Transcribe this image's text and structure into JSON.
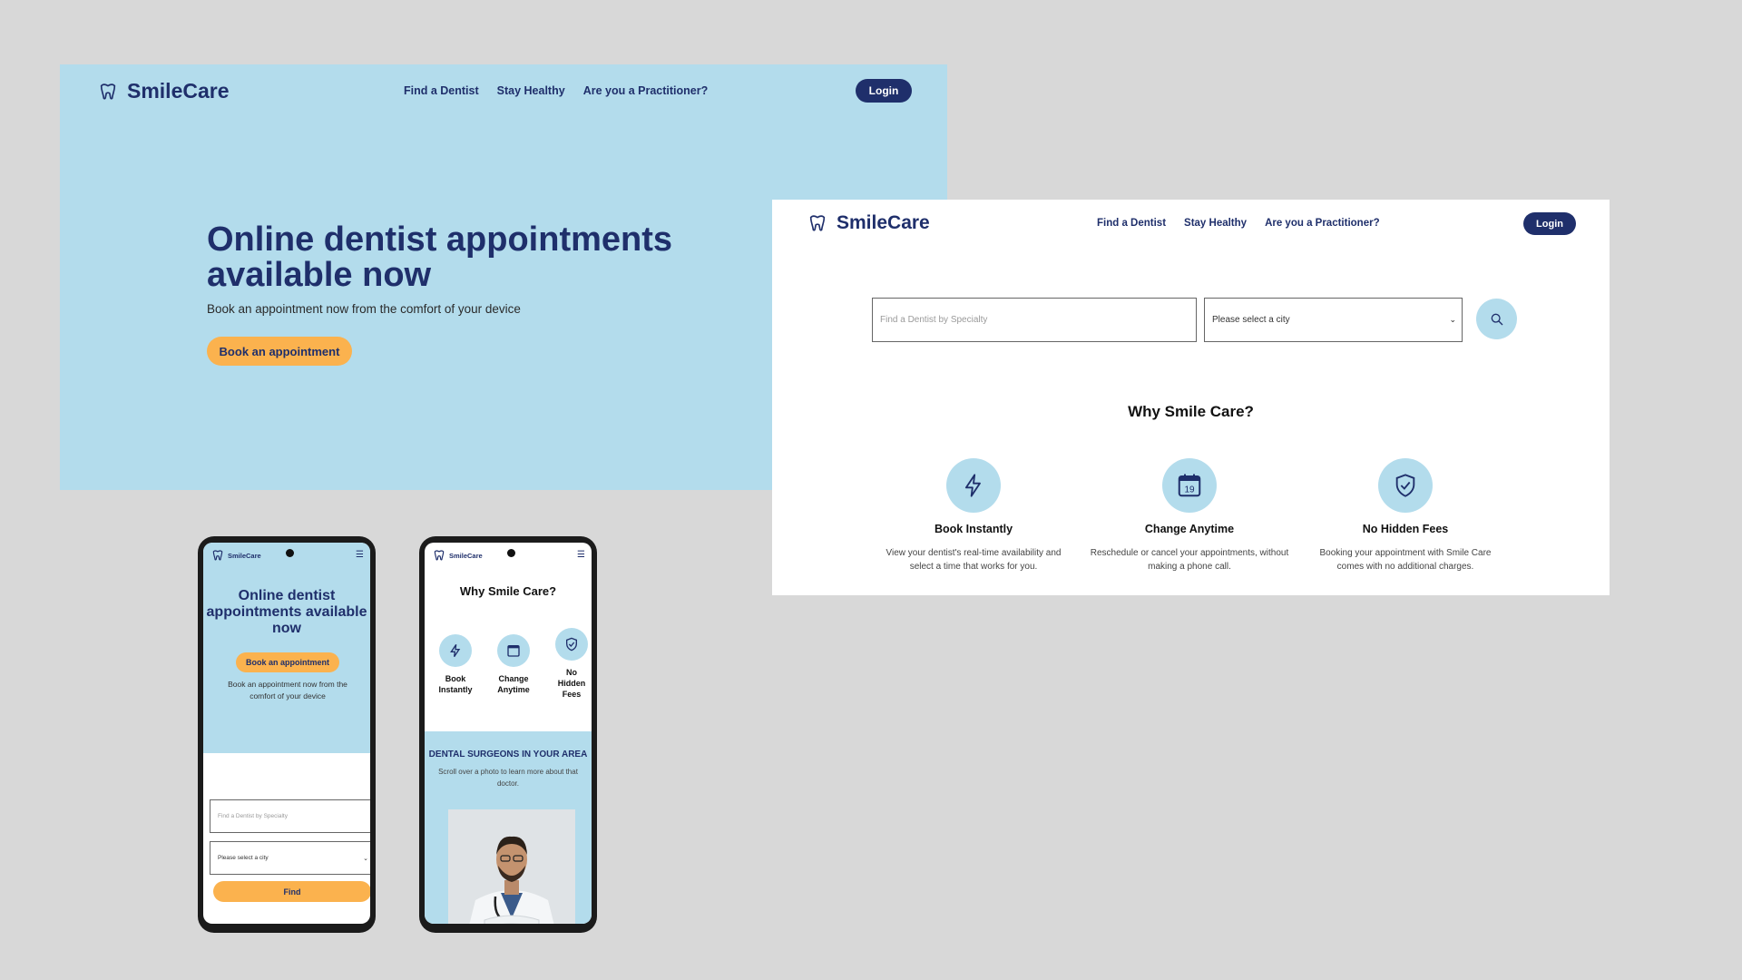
{
  "brand": {
    "name": "SmileCare",
    "primary_color": "#1f2f6b",
    "accent_color": "#fbb24e",
    "light_blue": "#b3dcec"
  },
  "nav": {
    "links": [
      "Find a Dentist",
      "Stay Healthy",
      "Are you a Practitioner?"
    ],
    "login_label": "Login"
  },
  "hero": {
    "title": "Online dentist appointments available now",
    "subtitle": "Book an appointment now from the comfort of your device",
    "cta_label": "Book an appointment"
  },
  "search": {
    "specialty_placeholder": "Find a Dentist by Specialty",
    "city_selected": "Please select a city",
    "find_label": "Find"
  },
  "why": {
    "title": "Why Smile Care?",
    "features": [
      {
        "icon": "lightning-icon",
        "title": "Book Instantly",
        "description": "View your dentist's real-time availability and select a time that works for you."
      },
      {
        "icon": "calendar-icon",
        "title": "Change Anytime",
        "description": "Reschedule or cancel your appointments, without making a phone call.",
        "calendar_day": "19"
      },
      {
        "icon": "shield-check-icon",
        "title": "No Hidden Fees",
        "description": "Booking your appointment with Smile Care comes with no additional charges."
      }
    ]
  },
  "mobile": {
    "hero_title": "Online dentist appointments available now",
    "surgeons_title": "DENTAL SURGEONS IN YOUR AREA",
    "surgeons_subtitle": "Scroll over a photo to learn more about that doctor."
  }
}
